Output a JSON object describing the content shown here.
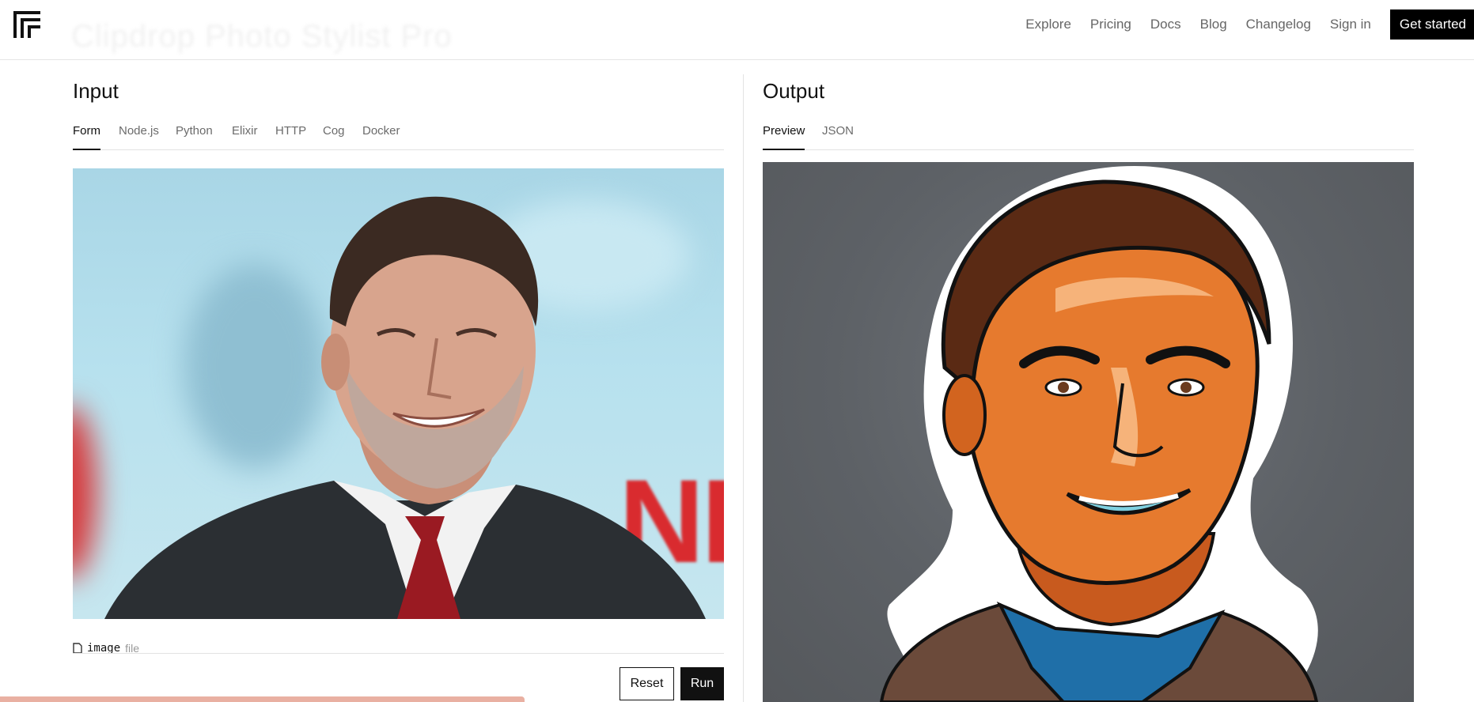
{
  "header": {
    "logo_icon": "replicate-logo-icon",
    "ghost_title": "Clipdrop Photo Stylist Pro",
    "nav": [
      {
        "label": "Explore"
      },
      {
        "label": "Pricing"
      },
      {
        "label": "Docs"
      },
      {
        "label": "Blog"
      },
      {
        "label": "Changelog"
      },
      {
        "label": "Sign in"
      }
    ],
    "cta_label": "Get started"
  },
  "input": {
    "title": "Input",
    "tabs": [
      "Form",
      "Node.js",
      "Python",
      "Elixir",
      "HTTP",
      "Cog",
      "Docker"
    ],
    "active_tab": "Form",
    "image_alt": "Photo of a smiling man in a dark suit and red tie in front of a blue backdrop",
    "backdrop_text": "NETFL",
    "field": {
      "icon": "file-icon",
      "name": "image",
      "type": "file"
    },
    "reset_label": "Reset",
    "run_label": "Run"
  },
  "output": {
    "title": "Output",
    "tabs": [
      "Preview",
      "JSON"
    ],
    "active_tab": "Preview",
    "image_alt": "Sticker-style illustrated portrait of the same man with a white outline on a grey background"
  },
  "colors": {
    "accent": "#000000",
    "netflix_red": "#d92b2f",
    "toast": "#e9b0a2"
  }
}
